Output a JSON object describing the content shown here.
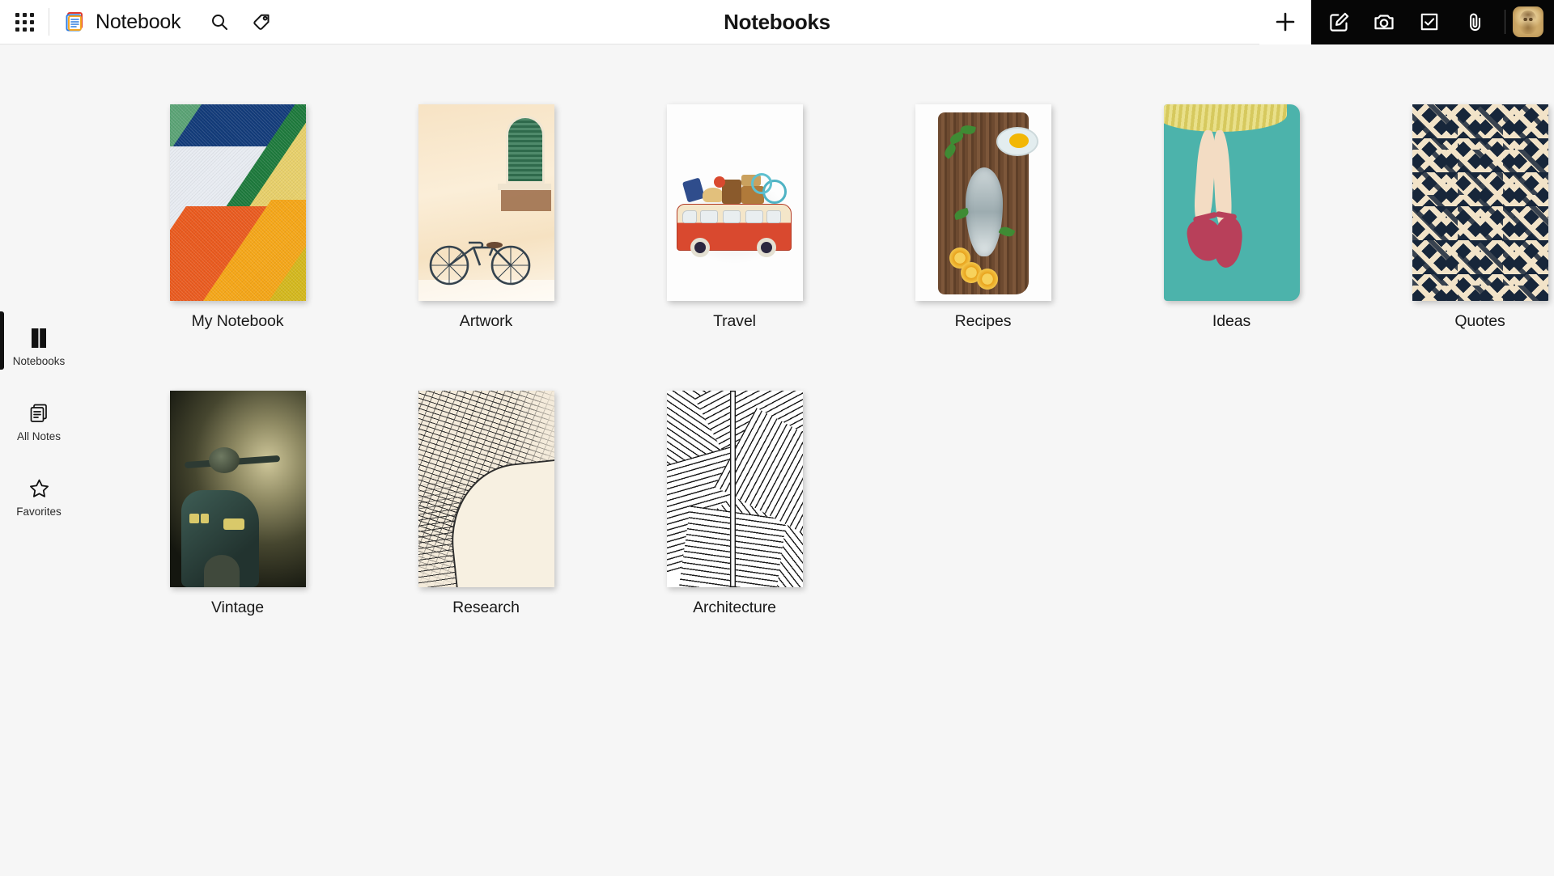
{
  "app": {
    "brand_name": "Notebook",
    "page_title": "Notebooks"
  },
  "header": {
    "apps_label": "apps-grid",
    "brand_icon": "notebook-logo-icon",
    "search_icon": "search-icon",
    "tag_icon": "tag-icon",
    "add_icon": "plus-icon",
    "actions": [
      {
        "name": "new-note",
        "icon": "edit-square-icon"
      },
      {
        "name": "new-photo-note",
        "icon": "camera-icon"
      },
      {
        "name": "new-checklist-note",
        "icon": "checkbox-icon"
      },
      {
        "name": "new-attachment-note",
        "icon": "paperclip-icon"
      }
    ],
    "avatar_label": "user-avatar"
  },
  "sidebar": {
    "items": [
      {
        "label": "Notebooks",
        "icon": "notebook-icon",
        "active": true
      },
      {
        "label": "All Notes",
        "icon": "all-notes-icon",
        "active": false
      },
      {
        "label": "Favorites",
        "icon": "star-icon",
        "active": false
      }
    ]
  },
  "notebooks": [
    {
      "title": "My Notebook",
      "cover": "geometric-color-blocks"
    },
    {
      "title": "Artwork",
      "cover": "watercolor-bicycle-wall"
    },
    {
      "title": "Travel",
      "cover": "red-van-with-luggage"
    },
    {
      "title": "Recipes",
      "cover": "fish-on-wooden-board"
    },
    {
      "title": "Ideas",
      "cover": "ballet-shoes-teal"
    },
    {
      "title": "Quotes",
      "cover": "navy-cream-maze-pattern"
    },
    {
      "title": "Vintage",
      "cover": "vintage-scooter-photo"
    },
    {
      "title": "Research",
      "cover": "zentangle-ink-drawing"
    },
    {
      "title": "Architecture",
      "cover": "black-white-line-art"
    }
  ],
  "colors": {
    "page_background": "#f6f6f6",
    "header_background": "#ffffff",
    "toolbar_dark": "#060606",
    "text_primary": "#1a1a1a",
    "active_indicator": "#111111"
  }
}
